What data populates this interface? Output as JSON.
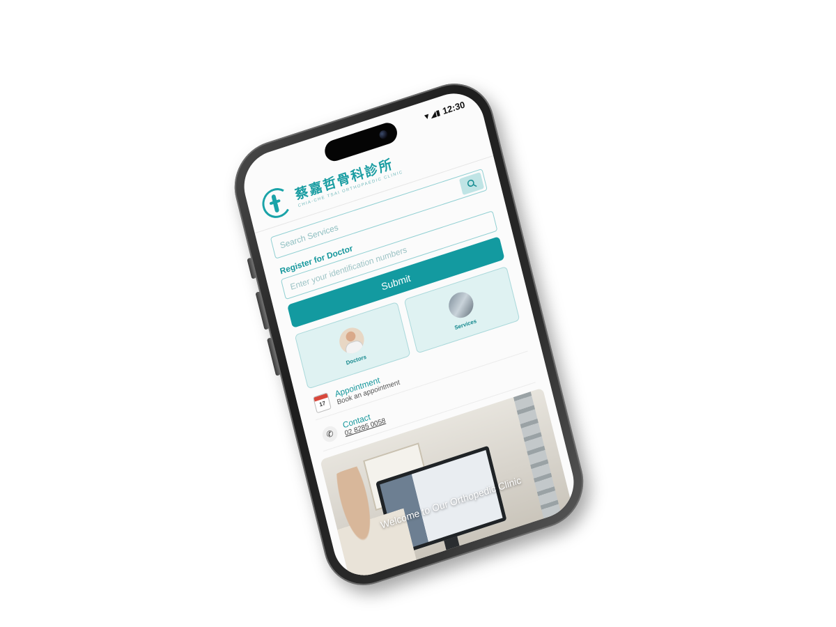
{
  "status_bar": {
    "time": "12:30"
  },
  "header": {
    "clinic_name_cn": "蔡嘉哲骨科診所",
    "clinic_name_en": "CHIA-CHE TSAI ORTHOPAEDIC CLINIC"
  },
  "search": {
    "placeholder": "Search Services"
  },
  "register": {
    "label": "Register for Doctor",
    "placeholder": "Enter your identification numbers",
    "submit_label": "Submit"
  },
  "cards": [
    {
      "label": "Doctors",
      "icon": "doctor-avatar"
    },
    {
      "label": "Services",
      "icon": "services-photo"
    }
  ],
  "list": [
    {
      "title": "Appointment",
      "subtitle": "Book an appointment",
      "icon": "calendar-icon",
      "icon_text": "17"
    },
    {
      "title": "Contact",
      "subtitle": "02 8285 0058",
      "icon": "phone-icon"
    }
  ],
  "hero": {
    "title": "Welcome to Our Orthopedic Clinic"
  },
  "colors": {
    "accent": "#139aa0",
    "card_bg": "#dff2f2"
  }
}
